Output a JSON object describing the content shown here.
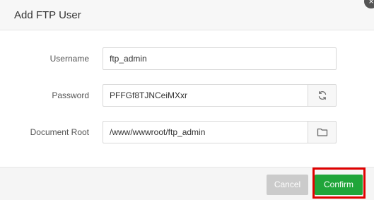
{
  "dialog": {
    "title": "Add FTP User",
    "close_glyph": "×"
  },
  "form": {
    "username": {
      "label": "Username",
      "value": "ftp_admin"
    },
    "password": {
      "label": "Password",
      "value": "PFFGf8TJNCeiMXxr",
      "action_icon": "refresh-icon"
    },
    "document_root": {
      "label": "Document Root",
      "value": "/www/wwwroot/ftp_admin",
      "action_icon": "folder-icon"
    }
  },
  "footer": {
    "cancel_label": "Cancel",
    "confirm_label": "Confirm"
  },
  "colors": {
    "confirm_bg": "#20a53a",
    "cancel_bg": "#cbcbcb",
    "highlight_frame": "#e00000"
  }
}
